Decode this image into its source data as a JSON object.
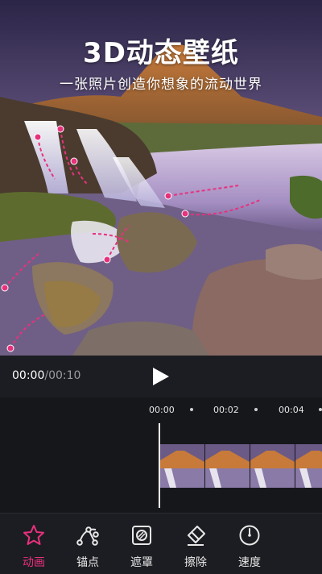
{
  "hero": {
    "title": "3D动态壁纸",
    "subtitle": "一张照片创造你想象的流动世界"
  },
  "player": {
    "current_time": "00:00",
    "separator_total": "/00:10",
    "play_icon": "play-icon"
  },
  "timeline": {
    "ticks": [
      "00:00",
      "00:02",
      "00:04"
    ]
  },
  "toolbar": {
    "items": [
      {
        "label": "动画",
        "icon": "star-icon",
        "active": true
      },
      {
        "label": "锚点",
        "icon": "anchor-path-icon",
        "active": false
      },
      {
        "label": "遮罩",
        "icon": "mask-icon",
        "active": false
      },
      {
        "label": "擦除",
        "icon": "eraser-icon",
        "active": false
      },
      {
        "label": "速度",
        "icon": "speed-gauge-icon",
        "active": false
      }
    ]
  },
  "colors": {
    "accent": "#e8317d",
    "background": "#1c1d22",
    "timeline_bg": "#16171b"
  }
}
